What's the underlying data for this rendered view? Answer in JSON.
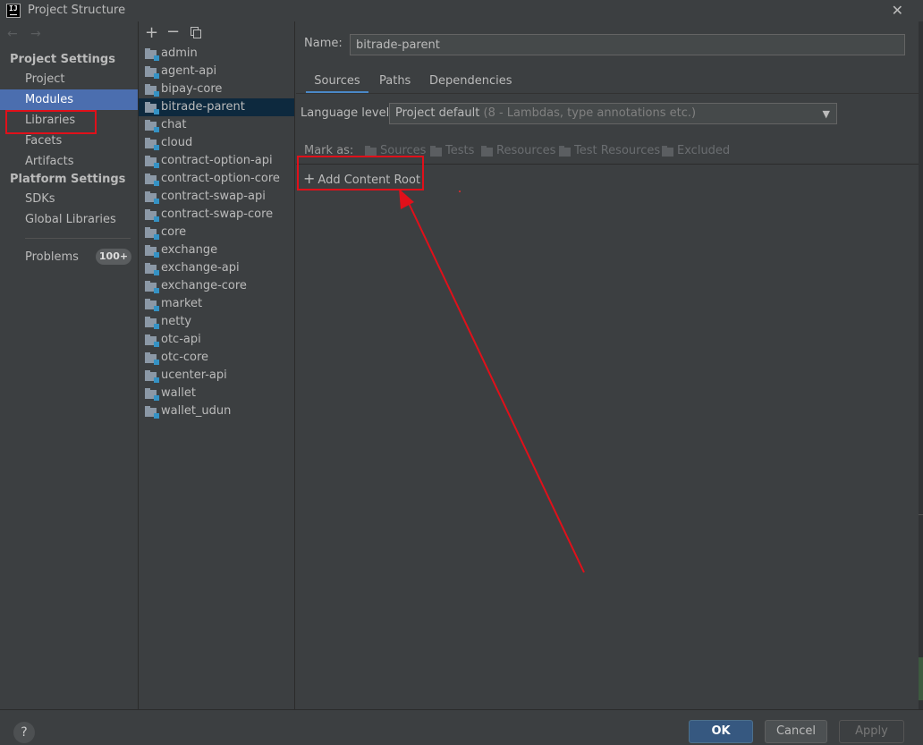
{
  "window": {
    "title": "Project Structure",
    "logo_text": "IJ"
  },
  "nav": {
    "project_settings_header": "Project Settings",
    "platform_settings_header": "Platform Settings",
    "items": {
      "project": "Project",
      "modules": "Modules",
      "libraries": "Libraries",
      "facets": "Facets",
      "artifacts": "Artifacts",
      "sdks": "SDKs",
      "global_libraries": "Global Libraries",
      "problems": "Problems"
    },
    "problems_badge": "100+",
    "selected": "Modules"
  },
  "modules": {
    "items": [
      "admin",
      "agent-api",
      "bipay-core",
      "bitrade-parent",
      "chat",
      "cloud",
      "contract-option-api",
      "contract-option-core",
      "contract-swap-api",
      "contract-swap-core",
      "core",
      "exchange",
      "exchange-api",
      "exchange-core",
      "market",
      "netty",
      "otc-api",
      "otc-core",
      "ucenter-api",
      "wallet",
      "wallet_udun"
    ],
    "selected": "bitrade-parent"
  },
  "detail": {
    "name_label": "Name:",
    "name_value": "bitrade-parent",
    "tabs": [
      "Sources",
      "Paths",
      "Dependencies"
    ],
    "active_tab": "Sources",
    "language_level_label": "Language level:",
    "language_level_value": "Project default",
    "language_level_detail": "(8 - Lambdas, type annotations etc.)",
    "mark_as_label": "Mark as:",
    "mark_as_options": [
      "Sources",
      "Tests",
      "Resources",
      "Test Resources",
      "Excluded"
    ],
    "add_content_root": "Add Content Root"
  },
  "buttons": {
    "ok": "OK",
    "cancel": "Cancel",
    "apply": "Apply",
    "help": "?"
  },
  "icons": {
    "close": "close-icon",
    "back": "back-arrow-icon",
    "forward": "forward-arrow-icon",
    "add": "plus-icon",
    "remove": "minus-icon",
    "copy": "copy-icon",
    "module": "module-folder-icon",
    "dropdown": "chevron-down-icon"
  },
  "colors": {
    "selection": "#4b6eaf",
    "annotation": "#e0101a",
    "ok_button": "#365880",
    "tab_underline": "#4a88c7"
  }
}
